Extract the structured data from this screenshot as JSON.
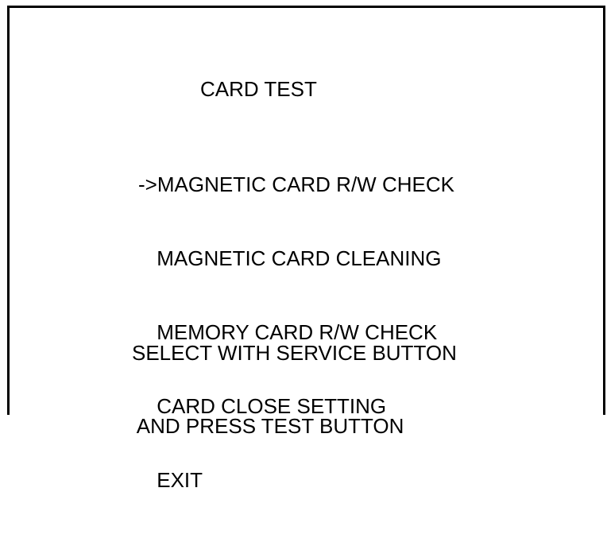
{
  "screen": {
    "title": "CARD TEST",
    "selection_marker": "->",
    "menu_items": [
      "MAGNETIC CARD R/W CHECK",
      " MAGNETIC CARD CLEANING",
      " MEMORY CARD R/W CHECK",
      " CARD CLOSE SETTING",
      " EXIT"
    ],
    "instructions": [
      "SELECT WITH SERVICE BUTTON",
      " AND PRESS TEST BUTTON"
    ]
  }
}
